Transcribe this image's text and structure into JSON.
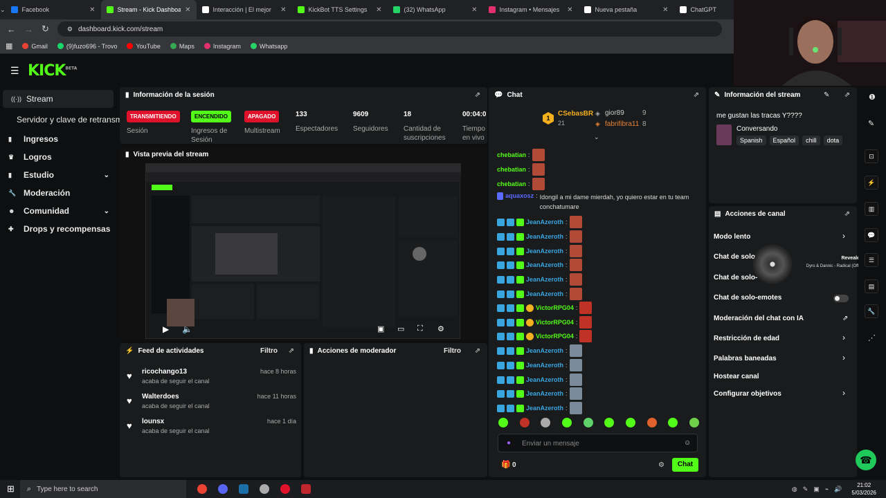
{
  "browser": {
    "tabs": [
      {
        "title": "Facebook",
        "color": "#1877f2"
      },
      {
        "title": "Stream - Kick Dashboard",
        "color": "#53fc18"
      },
      {
        "title": "Interacción | El mejor",
        "color": "#ffffff"
      },
      {
        "title": "KickBot TTS Settings",
        "color": "#53fc18"
      },
      {
        "title": "(32) WhatsApp",
        "color": "#25d366"
      },
      {
        "title": "Instagram • Mensajes",
        "color": "#e1306c"
      },
      {
        "title": "Nueva pestaña",
        "color": "#ffffff"
      },
      {
        "title": "ChatGPT",
        "color": "#ffffff"
      }
    ],
    "url": "dashboard.kick.com/stream",
    "bookmarks": [
      {
        "label": "Gmail",
        "color": "#ea4335"
      },
      {
        "label": "(9)fuzo696 - Trovo",
        "color": "#19d66b"
      },
      {
        "label": "YouTube",
        "color": "#ff0000"
      },
      {
        "label": "Maps",
        "color": "#34a853"
      },
      {
        "label": "Instagram",
        "color": "#e1306c"
      },
      {
        "label": "Whatsapp",
        "color": "#25d366"
      }
    ]
  },
  "brand": {
    "logo": "KICK",
    "beta": "BETA",
    "accent": "#53fc18"
  },
  "sidebar": {
    "items": [
      {
        "label": "Stream",
        "icon": "broadcast-icon"
      },
      {
        "label": "Servidor y clave de retransm",
        "icon": ""
      },
      {
        "label": "Ingresos",
        "icon": "chart-icon"
      },
      {
        "label": "Logros",
        "icon": "trophy-icon"
      },
      {
        "label": "Estudio",
        "icon": "studio-icon"
      },
      {
        "label": "Moderación",
        "icon": "wrench-icon"
      },
      {
        "label": "Comunidad",
        "icon": "people-icon"
      },
      {
        "label": "Drops y recompensas",
        "icon": "gift-icon"
      }
    ]
  },
  "session": {
    "title": "Información de la sesión",
    "stats": [
      {
        "badge": "TRANSMITIENDO",
        "badge_color": "#e0112b",
        "label": "Sesión"
      },
      {
        "badge": "ENCENDIDO",
        "badge_color": "#53fc18",
        "label": "Ingresos de Sesión"
      },
      {
        "badge": "APAGADO",
        "badge_color": "#e0112b",
        "label": "Multistream"
      },
      {
        "value": "133",
        "label": "Espectadores"
      },
      {
        "value": "9609",
        "label": "Seguidores"
      },
      {
        "value": "18",
        "label": "Cantidad de suscripciones"
      },
      {
        "value": "00:04:0",
        "label": "Tiempo en vivo"
      }
    ]
  },
  "preview": {
    "title": "Vista previa del stream"
  },
  "feed": {
    "title": "Feed de actividades",
    "filter": "Filtro",
    "items": [
      {
        "user": "ricochango13",
        "action": "acaba de seguir el canal",
        "time": "hace 8 horas"
      },
      {
        "user": "Walterdoes",
        "action": "acaba de seguir el canal",
        "time": "hace 11 horas"
      },
      {
        "user": "lounsx",
        "action": "acaba de seguir el canal",
        "time": "hace 1 día"
      }
    ]
  },
  "modactions": {
    "title": "Acciones de moderador",
    "filter": "Filtro"
  },
  "chat": {
    "title": "Chat",
    "leaderboard": [
      {
        "name": "CSebasBR",
        "count": "21"
      },
      {
        "name": "gior89",
        "count": "9"
      },
      {
        "name": "fabrifibra11",
        "count": "8"
      }
    ],
    "messages": [
      {
        "user": "chebatian",
        "text": "",
        "color": "#53fc18"
      },
      {
        "user": "chebatian",
        "text": "",
        "color": "#53fc18"
      },
      {
        "user": "chebatian",
        "text": "",
        "color": "#53fc18"
      },
      {
        "user": "aquaxosz",
        "text": "Idongil a mi dame mierdah, yo quiero estar en tu team conchatumare",
        "color": "#5b6bff"
      },
      {
        "user": "JeanAzeroth",
        "text": "",
        "color": "#3aa6e0"
      },
      {
        "user": "JeanAzeroth",
        "text": "",
        "color": "#3aa6e0"
      },
      {
        "user": "JeanAzeroth",
        "text": "",
        "color": "#3aa6e0"
      },
      {
        "user": "JeanAzeroth",
        "text": "",
        "color": "#3aa6e0"
      },
      {
        "user": "JeanAzeroth",
        "text": "",
        "color": "#3aa6e0"
      },
      {
        "user": "JeanAzeroth",
        "text": "",
        "color": "#3aa6e0"
      },
      {
        "user": "VictorRPG04",
        "text": "",
        "color": "#53fc18"
      },
      {
        "user": "VictorRPG04",
        "text": "",
        "color": "#53fc18"
      },
      {
        "user": "VictorRPG04",
        "text": "",
        "color": "#53fc18"
      },
      {
        "user": "JeanAzeroth",
        "text": "",
        "color": "#3aa6e0"
      },
      {
        "user": "JeanAzeroth",
        "text": "",
        "color": "#3aa6e0"
      },
      {
        "user": "JeanAzeroth",
        "text": "",
        "color": "#3aa6e0"
      },
      {
        "user": "JeanAzeroth",
        "text": "",
        "color": "#3aa6e0"
      },
      {
        "user": "JeanAzeroth",
        "text": "",
        "color": "#3aa6e0"
      }
    ],
    "input_placeholder": "Enviar un mensaje",
    "points": "0",
    "send": "Chat"
  },
  "streaminfo": {
    "title": "Información del stream",
    "stream_title": "me gustan las tracas Y????",
    "category": "Conversando",
    "tags": [
      "Spanish",
      "Español",
      "chill",
      "dota"
    ]
  },
  "channel": {
    "title": "Acciones de canal",
    "items": [
      "Modo lento",
      "Chat de solo",
      "Chat de solo-",
      "Chat de solo-emotes",
      "Moderación del chat con IA",
      "Restricción de edad",
      "Palabras baneadas",
      "Hostear canal",
      "Configurar objetivos"
    ],
    "music_title": "Revealed Music",
    "music_sub": "Dyro & Dannic - Radical (Official Music Video)"
  },
  "taskbar": {
    "search": "Type here to search",
    "time": "21:02",
    "date": "5/03/2026"
  }
}
